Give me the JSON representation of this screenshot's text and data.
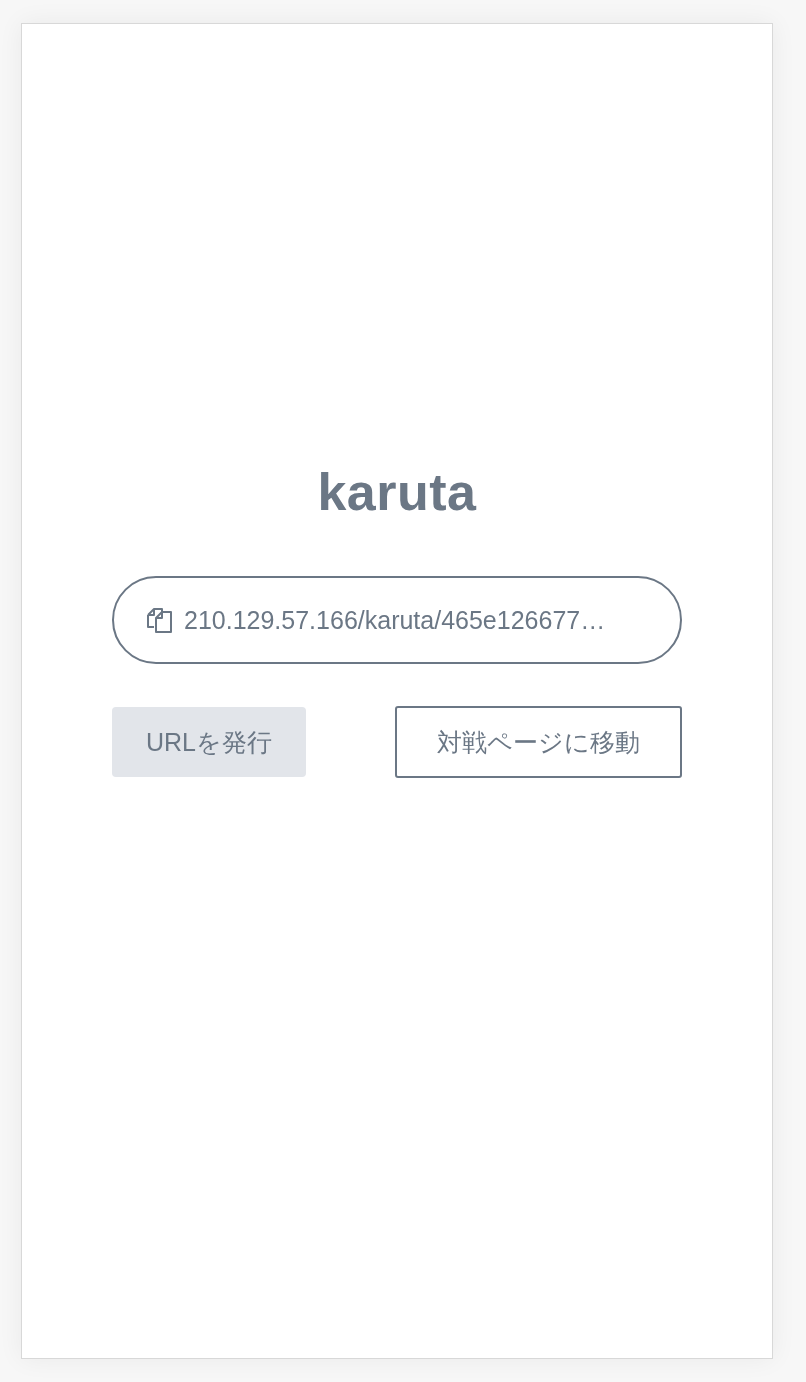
{
  "app": {
    "title": "karuta"
  },
  "url_field": {
    "value": "210.129.57.166/karuta/465e126677…"
  },
  "buttons": [
    {
      "label": "URLを発行",
      "kind": "filled"
    },
    {
      "label": "対戦ページに移動",
      "kind": "outlined"
    }
  ]
}
